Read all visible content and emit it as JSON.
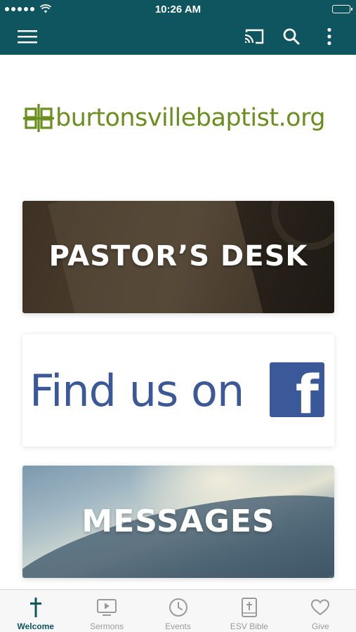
{
  "status_bar": {
    "time": "10:26 AM"
  },
  "logo": {
    "text": "burtonsvillebaptist.org"
  },
  "cards": [
    {
      "title": "PASTOR’S DESK"
    },
    {
      "title": "Find us on"
    },
    {
      "title": "MESSAGES"
    }
  ],
  "tabs": [
    {
      "label": "Welcome",
      "icon": "cross-icon",
      "active": true
    },
    {
      "label": "Sermons",
      "icon": "video-icon",
      "active": false
    },
    {
      "label": "Events",
      "icon": "clock-icon",
      "active": false
    },
    {
      "label": "ESV Bible",
      "icon": "bible-icon",
      "active": false
    },
    {
      "label": "Give",
      "icon": "heart-icon",
      "active": false
    }
  ],
  "colors": {
    "header": "#0f555f",
    "logo_green": "#6a8f1f",
    "facebook_blue": "#3b5998",
    "tab_inactive": "#9a9a9a"
  }
}
